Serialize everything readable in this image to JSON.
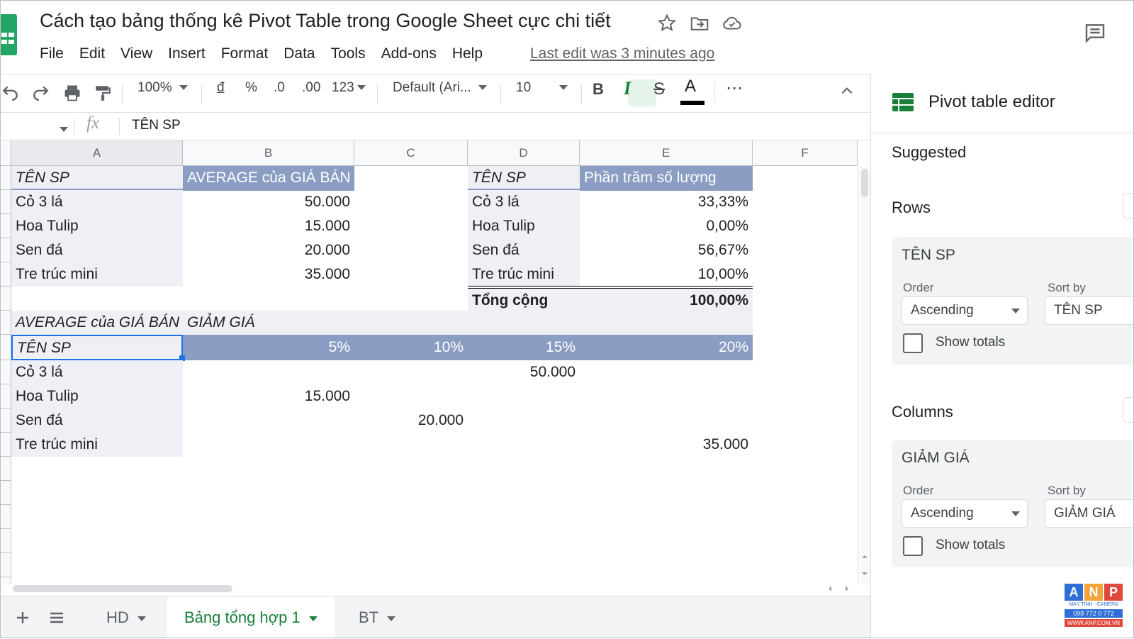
{
  "doc": {
    "title": "Cách tạo bảng thống kê Pivot Table trong Google Sheet cực chi tiết",
    "last_edit": "Last edit was 3 minutes ago"
  },
  "menu": [
    "File",
    "Edit",
    "View",
    "Insert",
    "Format",
    "Data",
    "Tools",
    "Add-ons",
    "Help"
  ],
  "toolbar": {
    "zoom": "100%",
    "currency": "đ",
    "percent": "%",
    "dec_decrease": ".0",
    "dec_increase": ".00",
    "number_format": "123",
    "font": "Default (Ari...",
    "font_size": "10",
    "bold": "B",
    "italic": "I",
    "strike": "S",
    "text_color": "A",
    "more": "⋯"
  },
  "formula": {
    "fx": "fx",
    "value": "TÊN SP"
  },
  "columns": [
    "A",
    "B",
    "C",
    "D",
    "E",
    "F"
  ],
  "pivot1": {
    "header_name": "TÊN SP",
    "header_value": "AVERAGE của GIÁ BÁN",
    "rows": [
      {
        "name": "Cỏ 3 lá",
        "value": "50.000"
      },
      {
        "name": "Hoa Tulip",
        "value": "15.000"
      },
      {
        "name": "Sen đá",
        "value": "20.000"
      },
      {
        "name": "Tre trúc mini",
        "value": "35.000"
      }
    ]
  },
  "pivot2": {
    "header_name": "TÊN SP",
    "header_value": "Phần trăm số lượng",
    "rows": [
      {
        "name": "Cỏ 3 lá",
        "value": "33,33%"
      },
      {
        "name": "Hoa Tulip",
        "value": "0,00%"
      },
      {
        "name": "Sen đá",
        "value": "56,67%"
      },
      {
        "name": "Tre trúc mini",
        "value": "10,00%"
      }
    ],
    "total_label": "Tổng cộng",
    "total_value": "100,00%"
  },
  "pivot3": {
    "values_label": "AVERAGE của GIÁ BÁN",
    "column_field": "GIẢM GIÁ",
    "row_field": "TÊN SP",
    "col_headers": [
      "5%",
      "10%",
      "15%",
      "20%"
    ],
    "rows": [
      {
        "name": "Cỏ 3 lá",
        "cells": [
          "",
          "",
          "50.000",
          ""
        ]
      },
      {
        "name": "Hoa Tulip",
        "cells": [
          "15.000",
          "",
          "",
          ""
        ]
      },
      {
        "name": "Sen đá",
        "cells": [
          "",
          "20.000",
          "",
          ""
        ]
      },
      {
        "name": "Tre trúc mini",
        "cells": [
          "",
          "",
          "",
          "35.000"
        ]
      }
    ]
  },
  "sheets": {
    "tabs": [
      "HD",
      "Bảng tổng hợp 1",
      "BT"
    ],
    "active": "Bảng tổng hợp 1"
  },
  "panel": {
    "title": "Pivot table editor",
    "suggested": "Suggested",
    "rows_label": "Rows",
    "columns_label": "Columns",
    "rows_card": {
      "field": "TÊN SP",
      "order_label": "Order",
      "order": "Ascending",
      "sort_label": "Sort by",
      "sort": "TÊN SP",
      "totals": "Show totals"
    },
    "cols_card": {
      "field": "GIẢM GIÁ",
      "order_label": "Order",
      "order": "Ascending",
      "sort_label": "Sort by",
      "sort": "GIẢM GIÁ",
      "totals": "Show totals"
    }
  },
  "watermark": {
    "letters": [
      "A",
      "N",
      "P"
    ],
    "line1": "MÁY TÍNH - CAMERA",
    "line2": "098 772 0 772",
    "line3": "WWW.ANP.COM.VN"
  },
  "colors": {
    "accent_green": "#188038",
    "pivot_header": "#8b9dc3",
    "pivot_shade": "#eef0f6",
    "selection": "#1a73e8"
  }
}
